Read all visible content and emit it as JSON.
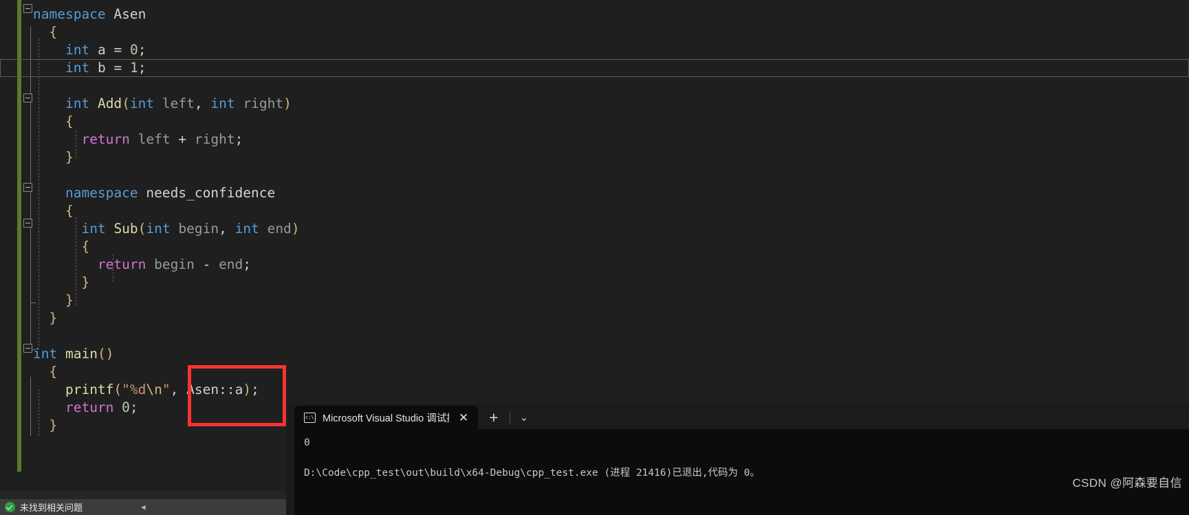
{
  "editor": {
    "language": "cpp",
    "lines": [
      {
        "indent": 0,
        "fold": true,
        "tokens": [
          {
            "t": "namespace",
            "c": "kw"
          },
          {
            "t": " ",
            "c": "op"
          },
          {
            "t": "Asen",
            "c": "typ"
          }
        ]
      },
      {
        "indent": 1,
        "fold": false,
        "tokens": [
          {
            "t": "{",
            "c": "pnc"
          }
        ]
      },
      {
        "indent": 2,
        "fold": false,
        "tokens": [
          {
            "t": "int",
            "c": "kw"
          },
          {
            "t": " ",
            "c": "op"
          },
          {
            "t": "a",
            "c": "var"
          },
          {
            "t": " = ",
            "c": "op"
          },
          {
            "t": "0",
            "c": "num"
          },
          {
            "t": ";",
            "c": "op"
          }
        ]
      },
      {
        "indent": 2,
        "fold": false,
        "current": true,
        "tokens": [
          {
            "t": "int",
            "c": "kw"
          },
          {
            "t": " ",
            "c": "op"
          },
          {
            "t": "b",
            "c": "var"
          },
          {
            "t": " = ",
            "c": "op"
          },
          {
            "t": "1",
            "c": "num"
          },
          {
            "t": ";",
            "c": "op"
          }
        ]
      },
      {
        "indent": 0,
        "fold": false,
        "tokens": []
      },
      {
        "indent": 2,
        "fold": true,
        "tokens": [
          {
            "t": "int",
            "c": "kw"
          },
          {
            "t": " ",
            "c": "op"
          },
          {
            "t": "Add",
            "c": "fn"
          },
          {
            "t": "(",
            "c": "pnc"
          },
          {
            "t": "int",
            "c": "kw"
          },
          {
            "t": " ",
            "c": "op"
          },
          {
            "t": "left",
            "c": "id"
          },
          {
            "t": ", ",
            "c": "op"
          },
          {
            "t": "int",
            "c": "kw"
          },
          {
            "t": " ",
            "c": "op"
          },
          {
            "t": "right",
            "c": "id"
          },
          {
            "t": ")",
            "c": "pnc"
          }
        ]
      },
      {
        "indent": 2,
        "fold": false,
        "tokens": [
          {
            "t": "{",
            "c": "pnc"
          }
        ]
      },
      {
        "indent": 3,
        "fold": false,
        "tokens": [
          {
            "t": "return",
            "c": "ret"
          },
          {
            "t": " ",
            "c": "op"
          },
          {
            "t": "left",
            "c": "id"
          },
          {
            "t": " + ",
            "c": "op"
          },
          {
            "t": "right",
            "c": "id"
          },
          {
            "t": ";",
            "c": "op"
          }
        ]
      },
      {
        "indent": 2,
        "fold": false,
        "tokens": [
          {
            "t": "}",
            "c": "pnc"
          }
        ]
      },
      {
        "indent": 0,
        "fold": false,
        "tokens": []
      },
      {
        "indent": 2,
        "fold": true,
        "tokens": [
          {
            "t": "namespace",
            "c": "kw"
          },
          {
            "t": " ",
            "c": "op"
          },
          {
            "t": "needs_confidence",
            "c": "typ"
          }
        ]
      },
      {
        "indent": 2,
        "fold": false,
        "tokens": [
          {
            "t": "{",
            "c": "pnc"
          }
        ]
      },
      {
        "indent": 3,
        "fold": true,
        "tokens": [
          {
            "t": "int",
            "c": "kw"
          },
          {
            "t": " ",
            "c": "op"
          },
          {
            "t": "Sub",
            "c": "fn"
          },
          {
            "t": "(",
            "c": "pnc"
          },
          {
            "t": "int",
            "c": "kw"
          },
          {
            "t": " ",
            "c": "op"
          },
          {
            "t": "begin",
            "c": "id"
          },
          {
            "t": ", ",
            "c": "op"
          },
          {
            "t": "int",
            "c": "kw"
          },
          {
            "t": " ",
            "c": "op"
          },
          {
            "t": "end",
            "c": "id"
          },
          {
            "t": ")",
            "c": "pnc"
          }
        ]
      },
      {
        "indent": 3,
        "fold": false,
        "tokens": [
          {
            "t": "{",
            "c": "pnc"
          }
        ]
      },
      {
        "indent": 4,
        "fold": false,
        "tokens": [
          {
            "t": "return",
            "c": "ret"
          },
          {
            "t": " ",
            "c": "op"
          },
          {
            "t": "begin",
            "c": "id"
          },
          {
            "t": " - ",
            "c": "op"
          },
          {
            "t": "end",
            "c": "id"
          },
          {
            "t": ";",
            "c": "op"
          }
        ]
      },
      {
        "indent": 3,
        "fold": false,
        "tokens": [
          {
            "t": "}",
            "c": "pnc"
          }
        ]
      },
      {
        "indent": 2,
        "fold": false,
        "tokens": [
          {
            "t": "}",
            "c": "pnc"
          }
        ]
      },
      {
        "indent": 1,
        "fold": false,
        "tokens": [
          {
            "t": "}",
            "c": "pnc"
          }
        ]
      },
      {
        "indent": 0,
        "fold": false,
        "tokens": []
      },
      {
        "indent": 0,
        "fold": true,
        "tokens": [
          {
            "t": "int",
            "c": "kw"
          },
          {
            "t": " ",
            "c": "op"
          },
          {
            "t": "main",
            "c": "fn"
          },
          {
            "t": "()",
            "c": "pnc"
          }
        ]
      },
      {
        "indent": 1,
        "fold": false,
        "tokens": [
          {
            "t": "{",
            "c": "pnc"
          }
        ]
      },
      {
        "indent": 2,
        "fold": false,
        "tokens": [
          {
            "t": "printf",
            "c": "fn"
          },
          {
            "t": "(",
            "c": "pnc"
          },
          {
            "t": "\"%d",
            "c": "str"
          },
          {
            "t": "\\n",
            "c": "esc"
          },
          {
            "t": "\"",
            "c": "str"
          },
          {
            "t": ", ",
            "c": "op"
          },
          {
            "t": "Asen",
            "c": "var"
          },
          {
            "t": "::",
            "c": "op"
          },
          {
            "t": "a",
            "c": "var"
          },
          {
            "t": ")",
            "c": "pnc"
          },
          {
            "t": ";",
            "c": "op"
          }
        ]
      },
      {
        "indent": 2,
        "fold": false,
        "tokens": [
          {
            "t": "return",
            "c": "ret"
          },
          {
            "t": " ",
            "c": "op"
          },
          {
            "t": "0",
            "c": "num"
          },
          {
            "t": ";",
            "c": "op"
          }
        ]
      },
      {
        "indent": 1,
        "fold": false,
        "tokens": [
          {
            "t": "}",
            "c": "pnc"
          }
        ]
      }
    ]
  },
  "annotation": {
    "highlight_color": "#f8332f",
    "highlighted_text": "Asen::a);"
  },
  "terminal": {
    "tab": {
      "icon": "console-icon",
      "label": "Microsoft Visual Studio 调试控",
      "close_label": "✕"
    },
    "new_tab_label": "+",
    "dropdown_label": "⌄",
    "output": [
      "0",
      "D:\\Code\\cpp_test\\out\\build\\x64-Debug\\cpp_test.exe (进程 21416)已退出,代码为 0。"
    ]
  },
  "statusbar": {
    "icon": "check-circle-icon",
    "message": "未找到相关问题",
    "collapse_arrow": "◀"
  },
  "watermark": {
    "text": "CSDN @阿森要自信"
  }
}
